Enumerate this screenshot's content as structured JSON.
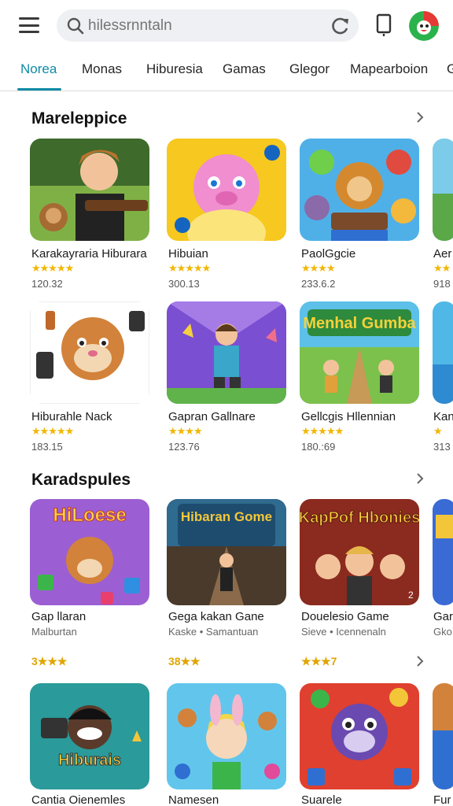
{
  "search": {
    "placeholder": "hilessrnntaln"
  },
  "tabs": [
    {
      "label": "Norea",
      "active": true
    },
    {
      "label": "Monas"
    },
    {
      "label": "Hiburesia"
    },
    {
      "label": "Gamas"
    },
    {
      "label": "Glegor"
    },
    {
      "label": "Mapearboion"
    },
    {
      "label": "G"
    }
  ],
  "colors": {
    "accent": "#0f8ba6",
    "star": "#f2b705"
  },
  "section1": {
    "title": "Mareleppice",
    "row1": [
      {
        "name": "Karakayraria Hiburara",
        "stars": "★★★★★",
        "num": "120.32"
      },
      {
        "name": "Hibuian",
        "stars": "★★★★★",
        "num": "300.13"
      },
      {
        "name": "PaolGgcie",
        "stars": "★★★★",
        "num": "233.6.2"
      },
      {
        "name": "Aer",
        "stars": "★★",
        "num": "918"
      }
    ],
    "row2": [
      {
        "name": "Hiburahle Nack",
        "stars": "★★★★★",
        "num": "183.15"
      },
      {
        "name": "Gapran Gallnare",
        "stars": "★★★★",
        "num": "123.76"
      },
      {
        "name": "Gellcgis Hllennian",
        "stars": "★★★★★",
        "num": "180.:69"
      },
      {
        "name": "Kan",
        "stars": "★",
        "num": "313"
      }
    ]
  },
  "section2": {
    "title": "Karadspules",
    "row1": [
      {
        "name": "Gap llaran",
        "sub": "Malburtan",
        "rating": "3★★★",
        "art": "HiLoese"
      },
      {
        "name": "Gega kakan Gane",
        "sub": "Kaske • Samantuan",
        "rating": "38★★",
        "art": "Hibaran Gome"
      },
      {
        "name": "Douelesio Game",
        "sub": "Sieve • Icennenaln",
        "rating": "★★★7",
        "art": "KapPof Hbonies"
      },
      {
        "name": "Gar",
        "sub": "Gko",
        "rating": "",
        "art": ""
      }
    ],
    "row2": [
      {
        "name": "Cantia Oienemles",
        "art": "Hiburais"
      },
      {
        "name": "Namesen"
      },
      {
        "name": "Suarele"
      },
      {
        "name": "Fur"
      }
    ]
  },
  "misc": {
    "badge_num": "2",
    "art_wordplay": "Menhal Gumba"
  }
}
